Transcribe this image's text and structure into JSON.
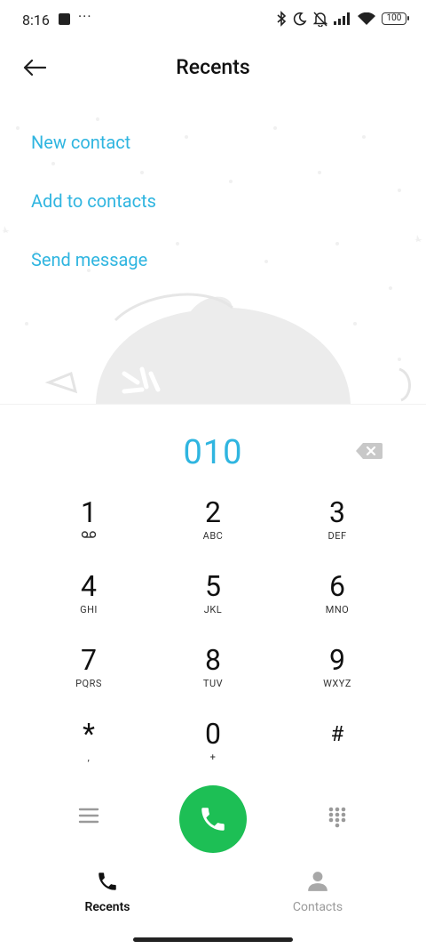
{
  "status_bar": {
    "time": "8:16",
    "more": "···",
    "battery": "100"
  },
  "header": {
    "title": "Recents"
  },
  "actions": [
    {
      "label": "New contact"
    },
    {
      "label": "Add to contacts"
    },
    {
      "label": "Send message"
    }
  ],
  "dialer": {
    "number": "010"
  },
  "keypad": {
    "keys": [
      {
        "num": "1",
        "sub": "voicemail"
      },
      {
        "num": "2",
        "sub": "ABC"
      },
      {
        "num": "3",
        "sub": "DEF"
      },
      {
        "num": "4",
        "sub": "GHI"
      },
      {
        "num": "5",
        "sub": "JKL"
      },
      {
        "num": "6",
        "sub": "MNO"
      },
      {
        "num": "7",
        "sub": "PQRS"
      },
      {
        "num": "8",
        "sub": "TUV"
      },
      {
        "num": "9",
        "sub": "WXYZ"
      },
      {
        "num": "*",
        "sub": ","
      },
      {
        "num": "0",
        "sub": "+"
      },
      {
        "num": "#",
        "sub": ""
      }
    ]
  },
  "bottom_nav": {
    "recents": "Recents",
    "contacts": "Contacts"
  },
  "colors": {
    "accent": "#2fb5e0",
    "call_green": "#1dbf55"
  }
}
